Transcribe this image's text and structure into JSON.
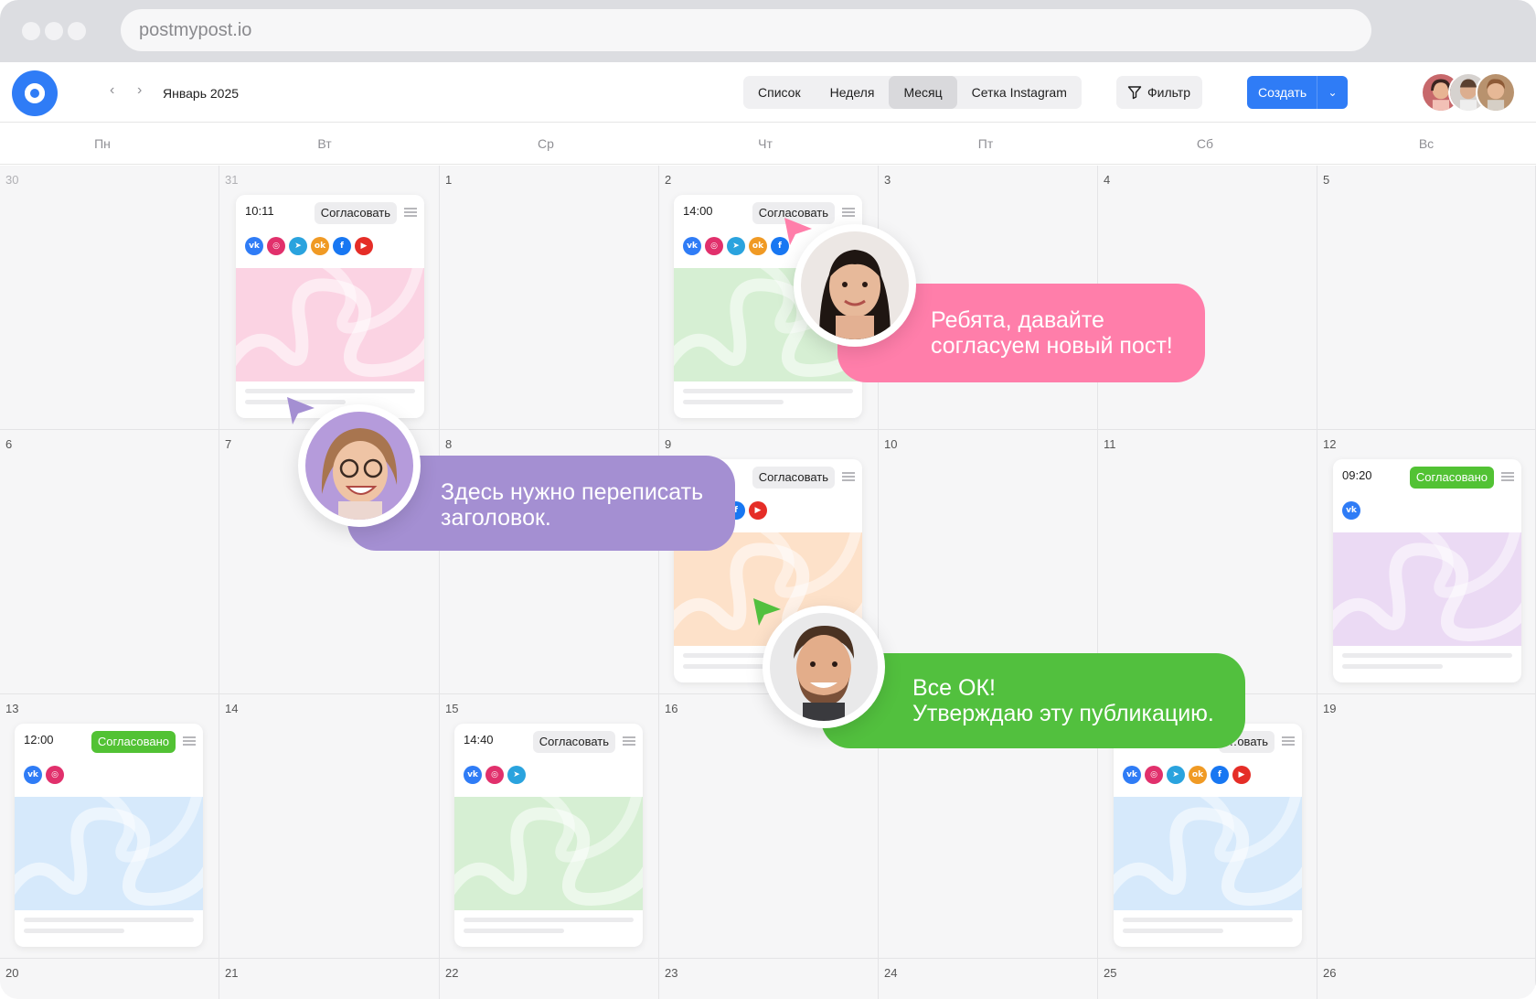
{
  "browser": {
    "url": "postmypost.io"
  },
  "toolbar": {
    "month": "Январь 2025",
    "views": [
      "Список",
      "Неделя",
      "Месяц",
      "Сетка Instagram"
    ],
    "active_view": "Месяц",
    "filter_label": "Фильтр",
    "create_label": "Создать"
  },
  "calendar": {
    "weekdays": [
      "Пн",
      "Вт",
      "Ср",
      "Чт",
      "Пт",
      "Сб",
      "Вс"
    ],
    "weeks": [
      [
        "30",
        "31",
        "1",
        "2",
        "3",
        "4",
        "5"
      ],
      [
        "6",
        "7",
        "8",
        "9",
        "10",
        "11",
        "12"
      ],
      [
        "13",
        "14",
        "15",
        "16",
        "17",
        "18",
        "19"
      ],
      [
        "20",
        "21",
        "22",
        "23",
        "24",
        "25",
        "26"
      ]
    ]
  },
  "posts": [
    {
      "time": "10:11",
      "status": "Согласовать",
      "networks": [
        "vk",
        "instagram",
        "telegram",
        "ok",
        "facebook",
        "youtube"
      ],
      "color": "#fbd3e3"
    },
    {
      "time": "14:00",
      "status": "Согласовать",
      "networks": [
        "vk",
        "instagram",
        "telegram",
        "ok",
        "facebook"
      ],
      "color": "#d6efd3"
    },
    {
      "time": "",
      "status": "Согласовать",
      "networks": [
        "telegram",
        "ok",
        "facebook",
        "youtube"
      ],
      "color": "#fde1c9"
    },
    {
      "time": "09:20",
      "status": "Согласовано",
      "networks": [
        "vk"
      ],
      "color": "#ebdaf4"
    },
    {
      "time": "12:00",
      "status": "Согласовано",
      "networks": [
        "vk",
        "instagram"
      ],
      "color": "#d6e9fb"
    },
    {
      "time": "14:40",
      "status": "Согласовать",
      "networks": [
        "vk",
        "instagram",
        "telegram"
      ],
      "color": "#d6efd3"
    },
    {
      "time": "",
      "status": "…овать",
      "networks": [
        "vk",
        "instagram",
        "telegram",
        "ok",
        "facebook",
        "youtube"
      ],
      "color": "#d6e9fb"
    }
  ],
  "comments": [
    {
      "lines": [
        "Ребята, давайте",
        "согласуем новый пост!"
      ],
      "color": "#ff7eaa"
    },
    {
      "lines": [
        "Здесь нужно переписать",
        "заголовок."
      ],
      "color": "#a48fd2"
    },
    {
      "lines": [
        "Все ОК!",
        "Утверждаю эту публикацию."
      ],
      "color": "#52c03e"
    }
  ]
}
